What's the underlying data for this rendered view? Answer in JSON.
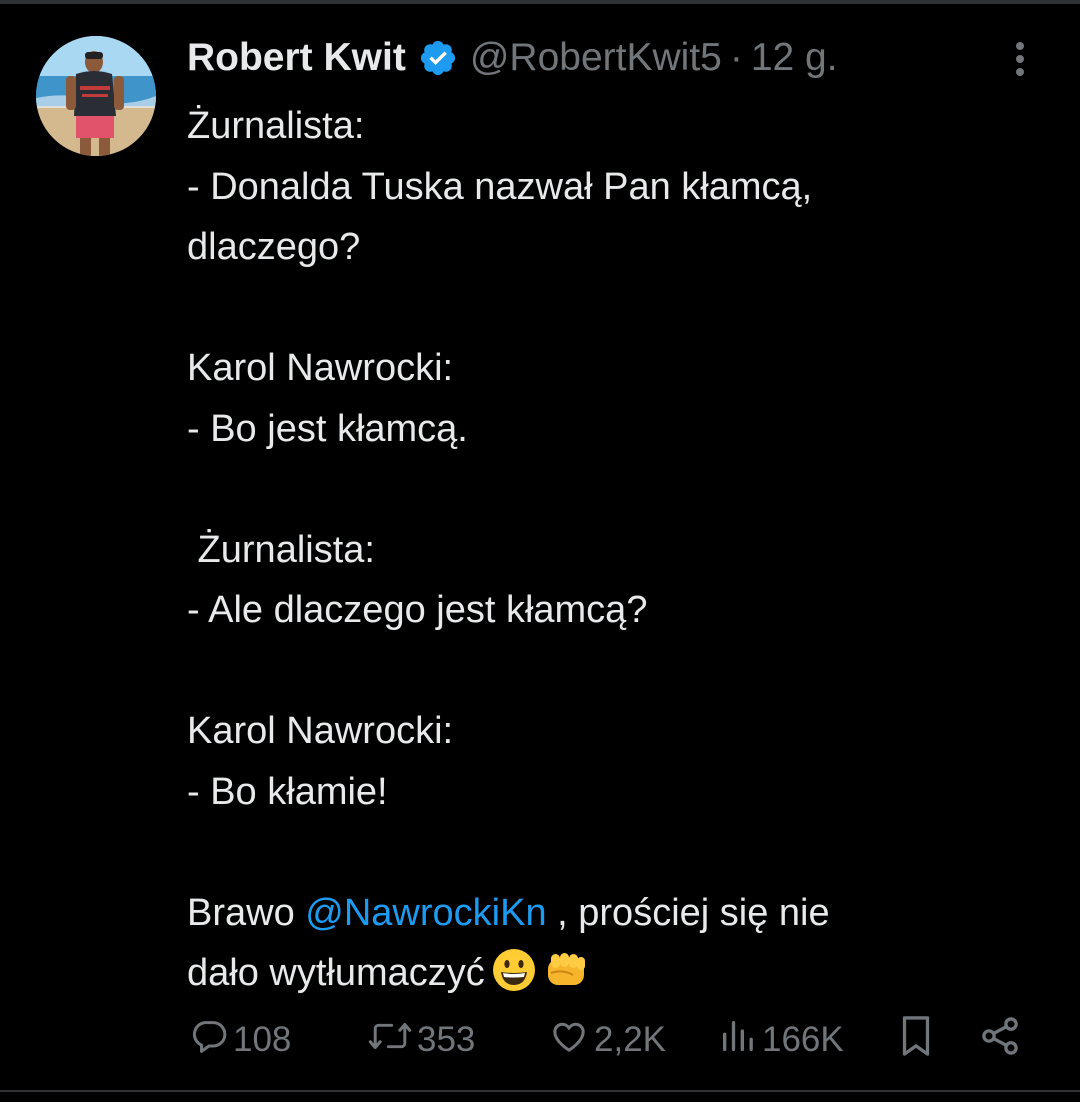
{
  "tweet": {
    "author_name": "Robert Kwit",
    "handle": "@RobertKwit5",
    "separator": "·",
    "time": "12 g.",
    "lines": [
      "Żurnalista:",
      "- Donalda Tuska nazwał Pan kłamcą,",
      "dlaczego?",
      "",
      "Karol Nawrocki:",
      "- Bo jest kłamcą.",
      "",
      " Żurnalista:",
      "- Ale dlaczego jest kłamcą?",
      "",
      "Karol Nawrocki:",
      "- Bo kłamie!",
      ""
    ],
    "closing_prefix": "Brawo ",
    "mention": "@NawrockiKn",
    "closing_suffix": " , prościej się nie",
    "closing_line2": "dało wytłumaczyć",
    "emojis": [
      "grinning-face-emoji",
      "oncoming-fist-emoji"
    ]
  },
  "actions": {
    "replies": "108",
    "reposts": "353",
    "likes": "2,2K",
    "views": "166K"
  },
  "icons": {
    "reply": "reply-icon",
    "repost": "repost-icon",
    "like": "heart-icon",
    "views": "views-icon",
    "bookmark": "bookmark-icon",
    "share": "share-icon",
    "verified": "verified-badge-icon",
    "more": "more-options-icon"
  },
  "colors": {
    "background": "#000000",
    "text": "#e7e9ea",
    "secondary": "#71767b",
    "accent": "#1d9bf0"
  }
}
